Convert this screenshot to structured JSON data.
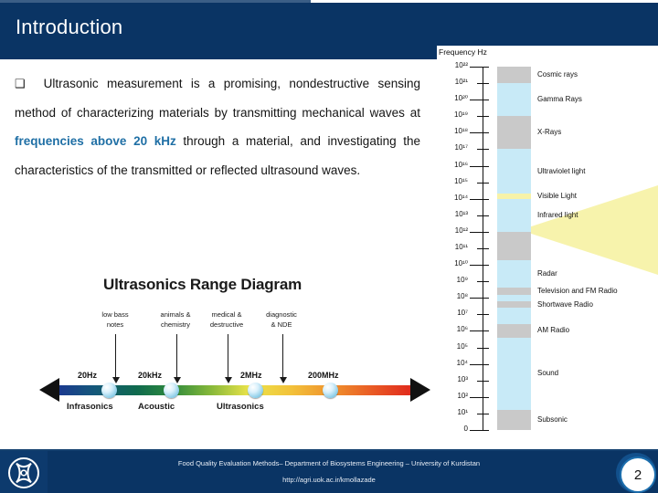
{
  "slide": {
    "title": "Introduction",
    "page_number": "2",
    "colors": {
      "header_bg": "#0a3464",
      "footer_bg": "#0a3464",
      "highlight_text": "#1f6fa5",
      "body_text": "#141414"
    }
  },
  "body": {
    "bullet_glyph": "❑",
    "segments": [
      {
        "text": "Ultrasonic measurement is a promising, nondestructive sensing method of characterizing materials by transmitting mechanical waves at ",
        "highlight": false
      },
      {
        "text": "frequencies above 20 kHz",
        "highlight": true
      },
      {
        "text": " through a material, and investigating the characteristics of the transmitted or reflected ultrasound waves.",
        "highlight": false
      }
    ],
    "full_text": "Ultrasonic measurement is a promising, nondestructive sensing method of characterizing materials by transmitting mechanical waves at frequencies above 20 kHz through a material, and investigating the characteristics of the transmitted or reflected ultrasound waves.",
    "highlight_phrase": "frequencies above 20 kHz"
  },
  "range_diagram": {
    "title": "Ultrasonics Range Diagram",
    "callouts": [
      {
        "label": "low bass\nnotes",
        "line1": "low bass",
        "line2": "notes"
      },
      {
        "label": "animals &\nchemistry",
        "line1": "animals &",
        "line2": "chemistry"
      },
      {
        "label": "medical &\ndestructive",
        "line1": "medical &",
        "line2": "destructive"
      },
      {
        "label": "diagnostic\n& NDE",
        "line1": "diagnostic",
        "line2": "& NDE"
      }
    ],
    "frequency_tags": [
      "20Hz",
      "20kHz",
      "2MHz",
      "200MHz"
    ],
    "band_labels": [
      "Infrasonics",
      "Acoustic",
      "Ultrasonics"
    ]
  },
  "chart_data": {
    "type": "bar",
    "title": "Frequency Hz",
    "caption": "Frequency Hz",
    "xlabel": "",
    "ylabel": "Frequency Hz",
    "axis_ticks": [
      "10²²",
      "10²¹",
      "10²⁰",
      "10¹⁹",
      "10¹⁸",
      "10¹⁷",
      "10¹⁶",
      "10¹⁵",
      "10¹⁴",
      "10¹³",
      "10¹²",
      "10¹¹",
      "10¹⁰",
      "10⁹",
      "10⁸",
      "10⁷",
      "10⁶",
      "10⁵",
      "10⁴",
      "10³",
      "10²",
      "10¹",
      "0"
    ],
    "exponents": [
      22,
      21,
      20,
      19,
      18,
      17,
      16,
      15,
      14,
      13,
      12,
      11,
      10,
      9,
      8,
      7,
      6,
      5,
      4,
      3,
      2,
      1,
      0
    ],
    "bands": [
      {
        "name": "Cosmic rays",
        "color": "#c9c9c9",
        "top_exp": 22,
        "bottom_exp": 21
      },
      {
        "name": "Gamma Rays",
        "color": "#c8eaf7",
        "top_exp": 21,
        "bottom_exp": 19
      },
      {
        "name": "X-Rays",
        "color": "#c9c9c9",
        "top_exp": 19,
        "bottom_exp": 17
      },
      {
        "name": "Ultraviolet light",
        "color": "#c8eaf7",
        "top_exp": 17,
        "bottom_exp": 14.3
      },
      {
        "name": "Visible Light",
        "color": "#f7f2a8",
        "top_exp": 14.3,
        "bottom_exp": 14.0
      },
      {
        "name": "Infrared light",
        "color": "#c8eaf7",
        "top_exp": 14.0,
        "bottom_exp": 12
      },
      {
        "name": "",
        "color": "#c9c9c9",
        "top_exp": 12,
        "bottom_exp": 10.3
      },
      {
        "name": "Radar",
        "color": "#c8eaf7",
        "top_exp": 10.3,
        "bottom_exp": 8.6
      },
      {
        "name": "Television and FM Radio",
        "color": "#c9c9c9",
        "top_exp": 8.6,
        "bottom_exp": 8.2
      },
      {
        "name": "",
        "color": "#c8eaf7",
        "top_exp": 8.2,
        "bottom_exp": 7.8
      },
      {
        "name": "Shortwave Radio",
        "color": "#c9c9c9",
        "top_exp": 7.8,
        "bottom_exp": 7.4
      },
      {
        "name": "",
        "color": "#c8eaf7",
        "top_exp": 7.4,
        "bottom_exp": 6.4
      },
      {
        "name": "AM Radio",
        "color": "#c9c9c9",
        "top_exp": 6.4,
        "bottom_exp": 5.6
      },
      {
        "name": "Sound",
        "color": "#c8eaf7",
        "top_exp": 5.6,
        "bottom_exp": 1.2
      },
      {
        "name": "Subsonic",
        "color": "#c9c9c9",
        "top_exp": 1.2,
        "bottom_exp": 0
      }
    ],
    "grid": false,
    "legend_position": "right"
  },
  "footer": {
    "line1": "Food Quality Evaluation Methods– Department of Biosystems Engineering – University of Kurdistan",
    "line2": "http://agri.uok.ac.ir/kmollazade",
    "logo_name": "university-logo"
  }
}
